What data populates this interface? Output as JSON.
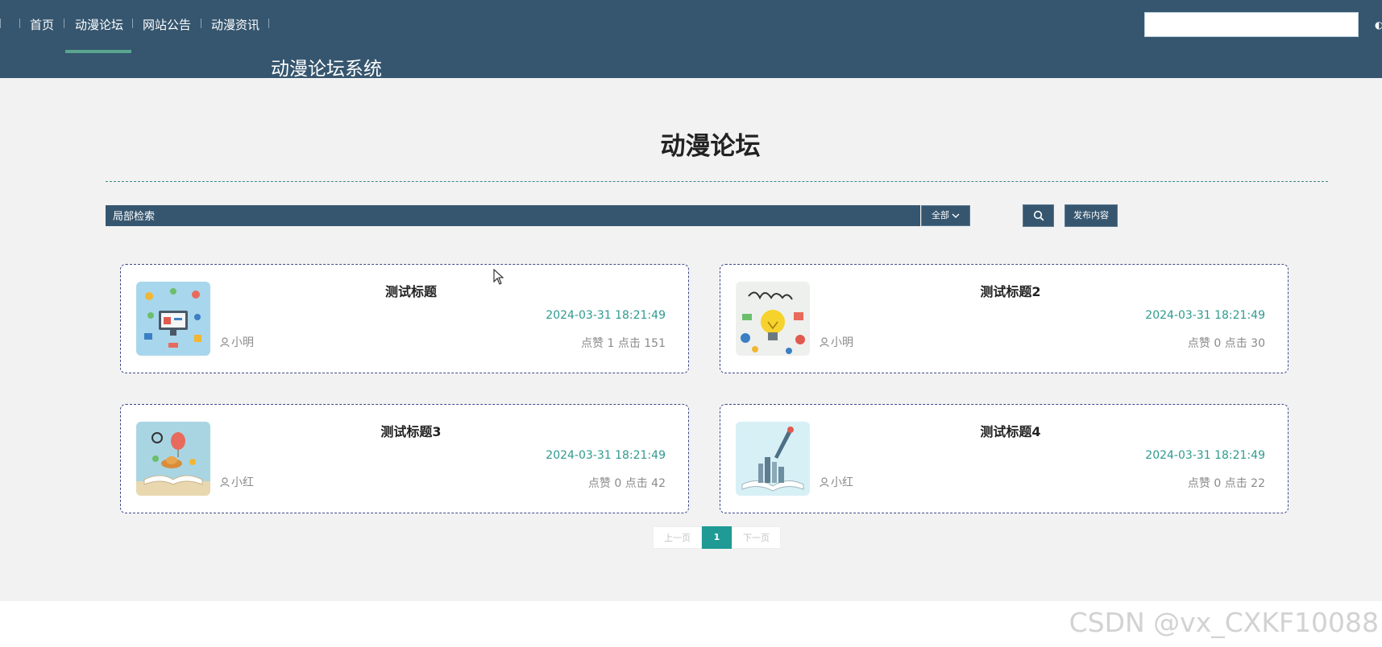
{
  "header": {
    "nav": [
      {
        "label": "首页"
      },
      {
        "label": "动漫论坛"
      },
      {
        "label": "网站公告"
      },
      {
        "label": "动漫资讯"
      }
    ],
    "active_nav": "动漫论坛",
    "site_title": "动漫论坛系统",
    "search_value": ""
  },
  "main": {
    "title": "动漫论坛",
    "filter": {
      "placeholder": "局部检索",
      "select_value": "全部"
    },
    "publish_label": "发布内容"
  },
  "posts": [
    {
      "title": "测试标题",
      "date": "2024-03-31 18:21:49",
      "author": "小明",
      "stats": "点赞 1 点击 151"
    },
    {
      "title": "测试标题2",
      "date": "2024-03-31 18:21:49",
      "author": "小明",
      "stats": "点赞 0 点击 30"
    },
    {
      "title": "测试标题3",
      "date": "2024-03-31 18:21:49",
      "author": "小红",
      "stats": "点赞 0 点击 42"
    },
    {
      "title": "测试标题4",
      "date": "2024-03-31 18:21:49",
      "author": "小红",
      "stats": "点赞 0 点击 22"
    }
  ],
  "pagination": {
    "prev_label": "上一页",
    "current": "1",
    "next_label": "下一页"
  },
  "watermark": "CSDN @vx_CXKF10088",
  "colors": {
    "header_bg": "#36566f",
    "accent_teal": "#1f9a94",
    "date_color": "#2f9a8f",
    "nav_underline": "#5aa58f"
  }
}
